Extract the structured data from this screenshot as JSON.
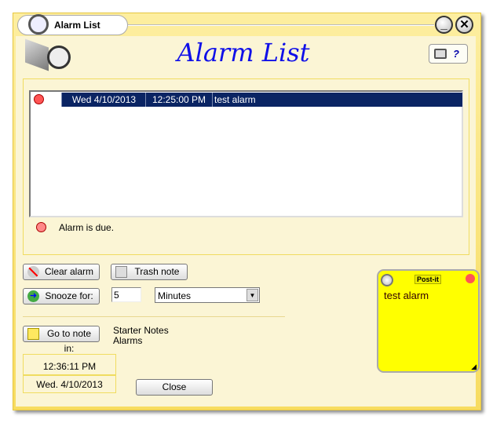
{
  "window": {
    "title": "Alarm List",
    "minimize_label": "_",
    "close_label": "✕"
  },
  "header": {
    "title": "Alarm List",
    "print_icon": "printer-icon",
    "help_icon": "help-icon",
    "help_glyph": "?"
  },
  "alarms": [
    {
      "icon": "alarm-clock-icon",
      "date": "Wed 4/10/2013",
      "time": "12:25:00 PM",
      "text": "test alarm",
      "selected": true
    }
  ],
  "status": {
    "icon": "alarm-clock-icon",
    "text": "Alarm is due."
  },
  "actions": {
    "clear_alarm": "Clear alarm",
    "trash_note": "Trash note",
    "snooze_for": "Snooze for:",
    "snooze_value": "5",
    "snooze_unit": "Minutes",
    "go_to_note": "Go to note in:",
    "notebook": "Starter Notes",
    "section": "Alarms"
  },
  "clock": {
    "time": "12:36:11 PM",
    "date": "Wed. 4/10/2013"
  },
  "close_label": "Close",
  "postit": {
    "logo": "Post-it",
    "text": "test alarm",
    "color": "#ffff00"
  },
  "colors": {
    "selection": "#0a2463",
    "heading": "#1010e8",
    "background": "#fbf5d5"
  }
}
